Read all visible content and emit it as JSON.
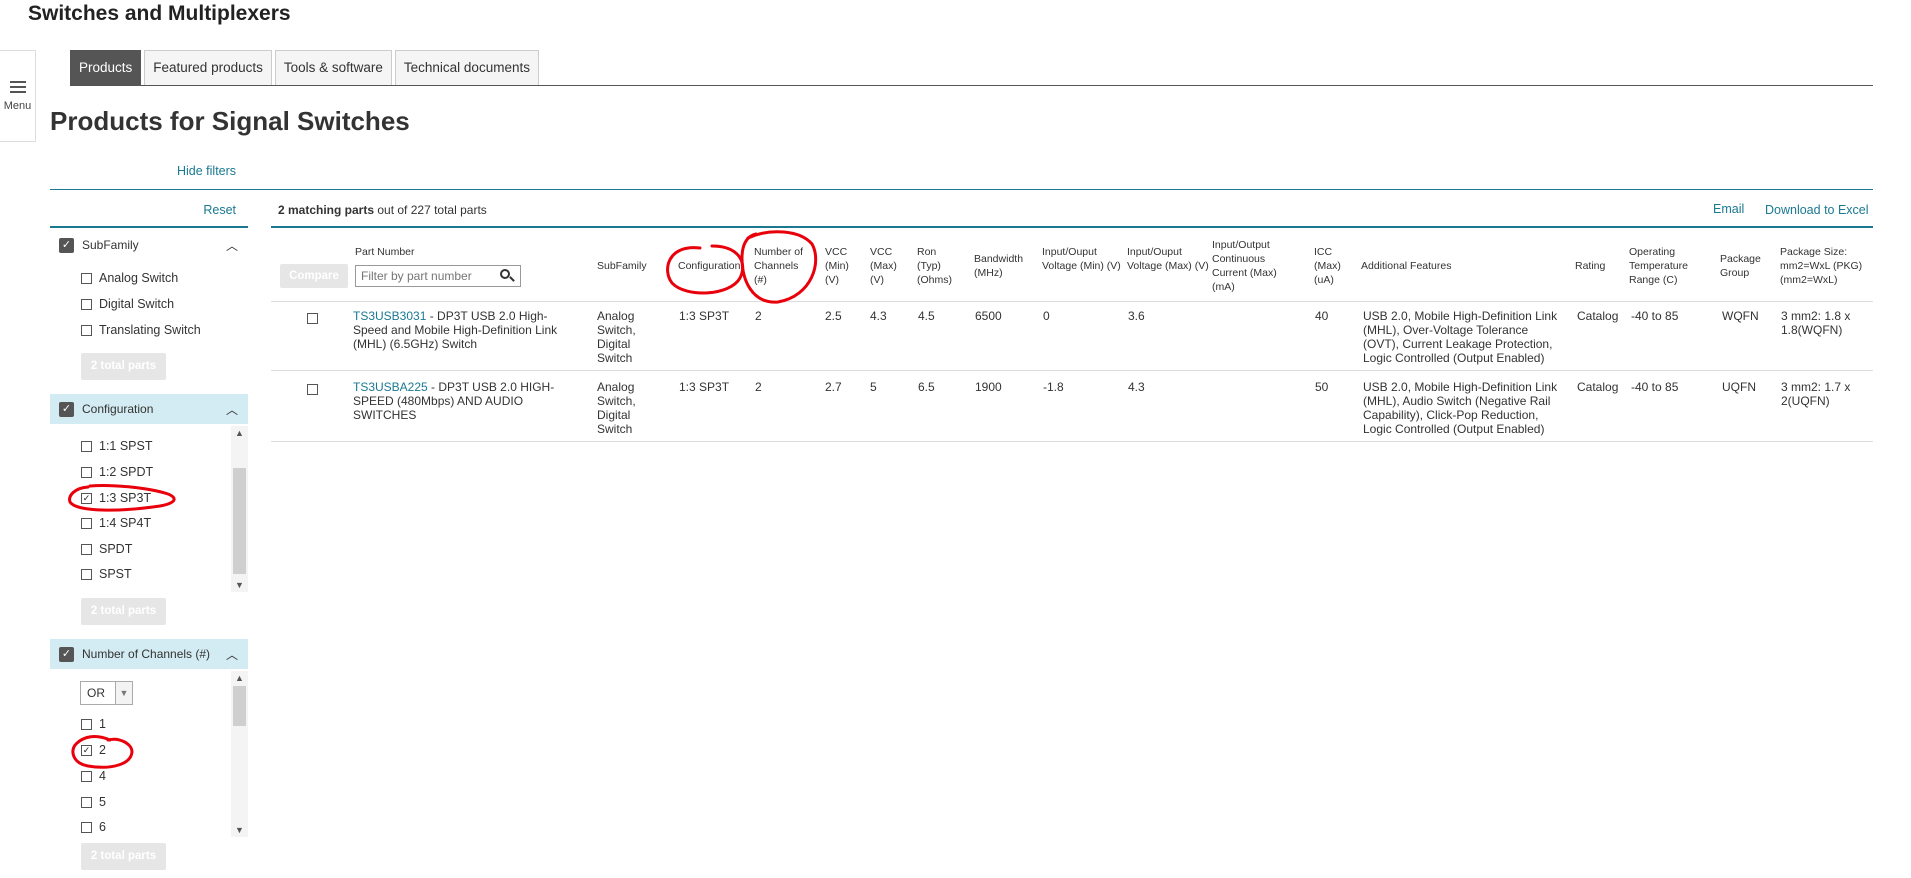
{
  "header": {
    "site_title": "Switches and Multiplexers",
    "menu_label": "Menu"
  },
  "tabs": [
    {
      "label": "Products",
      "active": true
    },
    {
      "label": "Featured products"
    },
    {
      "label": "Tools & software"
    },
    {
      "label": "Technical documents"
    }
  ],
  "page_title": "Products for Signal Switches",
  "filters": {
    "hide_label": "Hide filters",
    "reset_label": "Reset",
    "groups": [
      {
        "title": "SubFamily",
        "options": [
          {
            "label": "Analog Switch",
            "checked": false
          },
          {
            "label": "Digital Switch",
            "checked": false
          },
          {
            "label": "Translating Switch",
            "checked": false
          }
        ],
        "total_label": "2 total parts"
      },
      {
        "title": "Configuration",
        "options": [
          {
            "label": "1:1 SPST",
            "checked": false
          },
          {
            "label": "1:2 SPDT",
            "checked": false
          },
          {
            "label": "1:3 SP3T",
            "checked": true
          },
          {
            "label": "1:4 SP4T",
            "checked": false
          },
          {
            "label": "SPDT",
            "checked": false
          },
          {
            "label": "SPST",
            "checked": false
          }
        ],
        "total_label": "2 total parts"
      },
      {
        "title": "Number of Channels (#)",
        "logic_select": "OR",
        "options": [
          {
            "label": "1",
            "checked": false
          },
          {
            "label": "2",
            "checked": true
          },
          {
            "label": "4",
            "checked": false
          },
          {
            "label": "5",
            "checked": false
          },
          {
            "label": "6",
            "checked": false
          }
        ],
        "total_label": "2 total parts"
      }
    ]
  },
  "results": {
    "matching_count": "2 matching parts",
    "matching_rest": " out of 227 total parts",
    "email_label": "Email",
    "download_label": "Download to Excel",
    "compare_label": "Compare",
    "filter_placeholder": "Filter by part number",
    "columns": [
      "Part Number",
      "SubFamily",
      "Configuration",
      "Number of Channels (#)",
      "VCC (Min) (V)",
      "VCC (Max) (V)",
      "Ron (Typ) (Ohms)",
      "Bandwidth (MHz)",
      "Input/Ouput Voltage (Min) (V)",
      "Input/Ouput Voltage (Max) (V)",
      "Input/Output Continuous Current (Max) (mA)",
      "ICC (Max) (uA)",
      "Additional Features",
      "Rating",
      "Operating Temperature Range (C)",
      "Package Group",
      "Package Size: mm2=WxL (PKG) (mm2=WxL)"
    ],
    "rows": [
      {
        "part": "TS3USB3031",
        "desc": " - DP3T USB 2.0 High-Speed and Mobile High-Definition Link (MHL) (6.5GHz) Switch",
        "subfamily": "Analog Switch, Digital Switch",
        "configuration": "1:3 SP3T",
        "channels": "2",
        "vcc_min": "2.5",
        "vcc_max": "4.3",
        "ron": "4.5",
        "bandwidth": "6500",
        "io_min": "0",
        "io_max": "3.6",
        "io_current": "",
        "icc": "40",
        "features": "USB 2.0, Mobile High-Definition Link (MHL), Over-Voltage Tolerance (OVT), Current Leakage Protection, Logic Controlled (Output Enabled)",
        "rating": "Catalog",
        "temp": "-40 to 85",
        "pkg_group": "WQFN",
        "pkg_size": "3 mm2: 1.8 x 1.8(WQFN)"
      },
      {
        "part": "TS3USBA225",
        "desc": " - DP3T USB 2.0 HIGH-SPEED (480Mbps) AND AUDIO SWITCHES",
        "subfamily": "Analog Switch, Digital Switch",
        "configuration": "1:3 SP3T",
        "channels": "2",
        "vcc_min": "2.7",
        "vcc_max": "5",
        "ron": "6.5",
        "bandwidth": "1900",
        "io_min": "-1.8",
        "io_max": "4.3",
        "io_current": "",
        "icc": "50",
        "features": "USB 2.0, Mobile High-Definition Link (MHL), Audio Switch (Negative Rail Capability), Click-Pop Reduction, Logic Controlled (Output Enabled)",
        "rating": "Catalog",
        "temp": "-40 to 85",
        "pkg_group": "UQFN",
        "pkg_size": "3 mm2: 1.7 x 2(UQFN)"
      }
    ]
  },
  "colors": {
    "accent": "#1a7991",
    "annotation": "#e8000b",
    "tab_active": "#555555",
    "filter_head_bg": "#d3ebf2"
  }
}
